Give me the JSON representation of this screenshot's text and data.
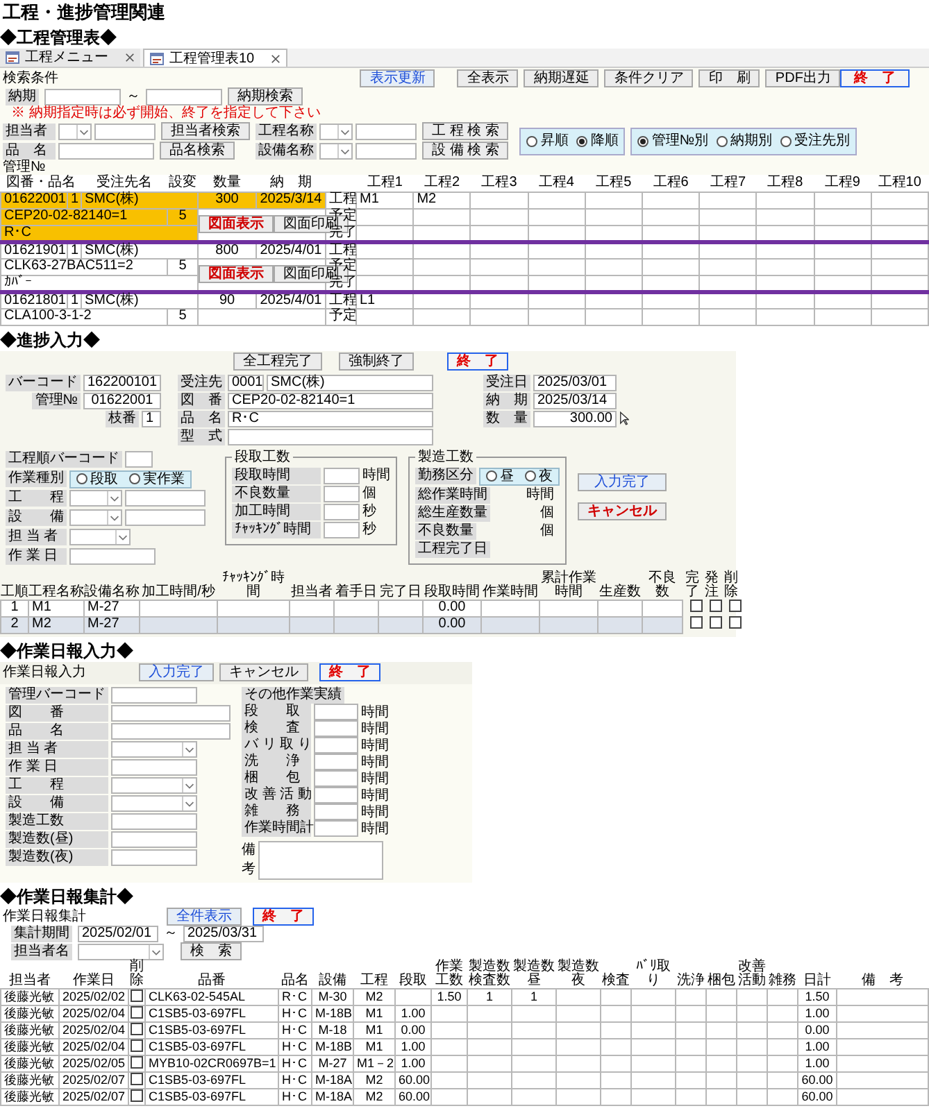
{
  "page_title": "工程・進捗管理関連",
  "schedule": {
    "heading": "◆工程管理表◆",
    "tabs": [
      {
        "label": "工程メニュー",
        "selected": false
      },
      {
        "label": "工程管理表10",
        "selected": true
      }
    ],
    "search_label": "検索条件",
    "top_buttons": [
      {
        "label": "表示更新",
        "kind": "blue"
      },
      {
        "label": "全表示",
        "kind": "plain"
      },
      {
        "label": "納期遅延",
        "kind": "plain"
      },
      {
        "label": "条件クリア",
        "kind": "plain"
      },
      {
        "label": "印　刷",
        "kind": "plain"
      },
      {
        "label": "PDF出力",
        "kind": "plain"
      }
    ],
    "close_button": {
      "label": "終　了",
      "kind": "close"
    },
    "due_label": "納期",
    "due_sep": "～",
    "due_button": {
      "label": "納期検索",
      "kind": "plain"
    },
    "warning": "※ 納期指定時は必ず開始、終了を指定して下さい",
    "filters": [
      {
        "label": "担当者",
        "kind": "combo",
        "button": {
          "label": "担当者検索",
          "kind": "plain"
        }
      },
      {
        "label": "品　名",
        "kind": "text",
        "button": {
          "label": "品名検索",
          "kind": "plain"
        }
      }
    ],
    "filters2": [
      {
        "label": "工程名称",
        "kind": "combo",
        "button": {
          "label": "工 程 検 索",
          "kind": "plain"
        }
      },
      {
        "label": "設備名称",
        "kind": "combo",
        "button": {
          "label": "設 備 検 索",
          "kind": "plain"
        }
      }
    ],
    "sort_order": [
      {
        "label": "昇順",
        "selected": false
      },
      {
        "label": "降順",
        "selected": true
      }
    ],
    "sort_key": [
      {
        "label": "管理№別",
        "selected": true
      },
      {
        "label": "納期別",
        "selected": false
      },
      {
        "label": "受注先別",
        "selected": false
      }
    ],
    "grid_caption": "管理№",
    "columns": [
      "図番・品名",
      "受注先名",
      "設変",
      "数量",
      "納　期",
      "工程1",
      "工程2",
      "工程3",
      "工程4",
      "工程5",
      "工程6",
      "工程7",
      "工程8",
      "工程9",
      "工程10"
    ],
    "records": [
      {
        "selected": true,
        "number": "01622001",
        "branch": "1",
        "customer": "SMC(株)",
        "quantity": "300",
        "due": "2025/3/14",
        "drawing": "CEP20-02-82140=1",
        "change": "5",
        "product": "R･C",
        "buttons": [
          {
            "label": "図面表示",
            "kind": "red"
          },
          {
            "label": "図面印刷",
            "kind": "plain"
          }
        ],
        "row_labels": [
          "工程",
          "予定",
          "完了"
        ],
        "processes": [
          "M1",
          "M2"
        ]
      },
      {
        "selected": false,
        "number": "01621901",
        "branch": "1",
        "customer": "SMC(株)",
        "quantity": "800",
        "due": "2025/4/01",
        "drawing": "CLK63-27BAC511=2",
        "change": "5",
        "product": "ｶﾊﾞｰ",
        "buttons": [
          {
            "label": "図面表示",
            "kind": "red"
          },
          {
            "label": "図面印刷",
            "kind": "plain"
          }
        ],
        "row_labels": [
          "工程",
          "予定",
          "完了"
        ]
      },
      {
        "selected": false,
        "number": "01621801",
        "branch": "1",
        "customer": "SMC(株)",
        "quantity": "90",
        "due": "2025/4/01",
        "drawing": "CLA100-3-1-2",
        "change": "5",
        "row_labels": [
          "工程",
          "予定"
        ],
        "processes": [
          "L1"
        ]
      }
    ]
  },
  "progress": {
    "heading": "◆進捗入力◆",
    "buttons": [
      {
        "label": "全工程完了",
        "kind": "plain"
      },
      {
        "label": "強制終了",
        "kind": "plain"
      },
      {
        "label": "終　了",
        "kind": "close"
      }
    ],
    "info_left": [
      {
        "label": "バーコード",
        "value": "162200101"
      },
      {
        "label": "管理№",
        "value": "01622001"
      },
      {
        "label": "枝番",
        "value": "1"
      }
    ],
    "info_mid": [
      {
        "label": "受注先",
        "values": [
          "0001",
          "SMC(株)"
        ]
      },
      {
        "label": "図　番",
        "values": [
          "CEP20-02-82140=1"
        ]
      },
      {
        "label": "品　名",
        "values": [
          "R･C"
        ]
      },
      {
        "label": "型　式"
      }
    ],
    "info_right": [
      {
        "label": "受注日",
        "value": "2025/03/01"
      },
      {
        "label": "納　期",
        "value": "2025/03/14"
      },
      {
        "label": "数　量",
        "value": "300.00"
      }
    ],
    "entry": [
      {
        "label": "工程順バーコード",
        "kind": "text"
      },
      {
        "label": "作業種別",
        "kind": "radio",
        "options": [
          {
            "label": "段取",
            "selected": false
          },
          {
            "label": "実作業",
            "selected": false
          }
        ]
      },
      {
        "label": "工　　程",
        "kind": "combo_text"
      },
      {
        "label": "設　　備",
        "kind": "combo_text"
      },
      {
        "label": "担 当 者",
        "kind": "combo"
      },
      {
        "label": "作 業 日",
        "kind": "text"
      }
    ],
    "setup": {
      "title": "段取工数",
      "rows": [
        {
          "label": "段取時間",
          "unit": "時間"
        },
        {
          "label": "不良数量",
          "unit": "個"
        },
        {
          "label": "加工時間",
          "unit": "秒"
        },
        {
          "label": "ﾁｬｯｷﾝｸﾞ時間",
          "unit": "秒"
        }
      ]
    },
    "production": {
      "title": "製造工数",
      "shift_label": "勤務区分",
      "shift": [
        {
          "label": "昼",
          "selected": false
        },
        {
          "label": "夜",
          "selected": false
        }
      ],
      "rows": [
        {
          "label": "総作業時間",
          "unit": "時間"
        },
        {
          "label": "総生産数量",
          "unit": "個"
        },
        {
          "label": "不良数量",
          "unit": "個"
        },
        {
          "label": "工程完了日"
        }
      ]
    },
    "side_buttons": [
      {
        "label": "入力完了",
        "kind": "blue"
      },
      {
        "label": "キャンセル",
        "kind": "red"
      }
    ],
    "table": {
      "columns": [
        "工順",
        "工程名称",
        "設備名称",
        "加工時間/秒",
        "ﾁｬｯｷﾝｸﾞ時間",
        "担当者",
        "着手日",
        "完了日",
        "段取時間",
        "作業時間",
        "累計作業時間",
        "生産数",
        "不良数",
        "完了",
        "発注",
        "削除"
      ],
      "rows": [
        {
          "selected": false,
          "cells": [
            "1",
            "M1",
            "M-27",
            "",
            "",
            "",
            "",
            "",
            "0.00",
            "",
            "",
            "",
            "",
            {
              "checked": false
            },
            {
              "checked": false
            },
            {
              "checked": false
            }
          ]
        },
        {
          "selected": true,
          "cells": [
            "2",
            "M2",
            "M-27",
            "",
            "",
            "",
            "",
            "",
            "0.00",
            "",
            "",
            "",
            "",
            {
              "checked": false
            },
            {
              "checked": false
            },
            {
              "checked": false
            }
          ]
        }
      ]
    }
  },
  "daily": {
    "heading": "◆作業日報入力◆",
    "title": "作業日報入力",
    "buttons": [
      {
        "label": "入力完了",
        "kind": "blue"
      },
      {
        "label": "キャンセル",
        "kind": "plain"
      },
      {
        "label": "終　了",
        "kind": "close"
      }
    ],
    "fields": [
      {
        "label": "管理バーコード",
        "kind": "text"
      },
      {
        "label": "図　　番",
        "kind": "wide"
      },
      {
        "label": "品　　名",
        "kind": "wide"
      },
      {
        "label": "担 当 者",
        "kind": "combo"
      },
      {
        "label": "作 業 日",
        "kind": "text"
      },
      {
        "label": "工　　程",
        "kind": "combo"
      },
      {
        "label": "設　　備",
        "kind": "combo"
      },
      {
        "label": "製造工数",
        "kind": "text"
      },
      {
        "label": "製造数(昼)",
        "kind": "text"
      },
      {
        "label": "製造数(夜)",
        "kind": "text"
      }
    ],
    "other_title": "その他作業実績",
    "other_rows": [
      {
        "label": "段　　取",
        "unit": "時間"
      },
      {
        "label": "検　　査",
        "unit": "時間"
      },
      {
        "label": "バ リ 取 り",
        "unit": "時間"
      },
      {
        "label": "洗　　浄",
        "unit": "時間"
      },
      {
        "label": "梱　　包",
        "unit": "時間"
      },
      {
        "label": "改 善 活 動",
        "unit": "時間"
      },
      {
        "label": "雑　　務",
        "unit": "時間"
      },
      {
        "label": "作業時間計",
        "unit": "時間"
      }
    ],
    "remarks_label": "備考"
  },
  "summary": {
    "heading": "◆作業日報集計◆",
    "title": "作業日報集計",
    "buttons": [
      {
        "label": "全件表示",
        "kind": "blue"
      },
      {
        "label": "終　了",
        "kind": "close"
      }
    ],
    "period_label": "集計期間",
    "period_from": "2025/02/01",
    "period_sep": "～",
    "period_to": "2025/03/31",
    "person_label": "担当者名",
    "search_button": {
      "label": "検　索",
      "kind": "plain"
    },
    "columns": [
      "担当者",
      "作業日",
      "削除",
      "品番",
      "品名",
      "設備",
      "工程",
      "段取",
      "作業工数",
      "製造数検査数",
      "製造数昼",
      "製造数夜",
      "検査",
      "ﾊﾞﾘ取り",
      "洗浄",
      "梱包",
      "改善活動",
      "雑務",
      "日計",
      "備　考"
    ],
    "rows": [
      {
        "cells": [
          "後藤光敏",
          "2025/02/02",
          {
            "checked": false
          },
          "CLK63-02-545AL",
          "R･C",
          "M-30",
          "M2",
          "",
          "1.50",
          "1",
          "1",
          "",
          "",
          "",
          "",
          "",
          "",
          "",
          "1.50",
          ""
        ]
      },
      {
        "cells": [
          "後藤光敏",
          "2025/02/04",
          {
            "checked": false
          },
          "C1SB5-03-697FL",
          "H･C",
          "M-18B",
          "M1",
          "1.00",
          "",
          "",
          "",
          "",
          "",
          "",
          "",
          "",
          "",
          "",
          "1.00",
          ""
        ]
      },
      {
        "cells": [
          "後藤光敏",
          "2025/02/04",
          {
            "checked": false
          },
          "C1SB5-03-697FL",
          "H･C",
          "M-18",
          "M1",
          "0.00",
          "",
          "",
          "",
          "",
          "",
          "",
          "",
          "",
          "",
          "",
          "0.00",
          ""
        ]
      },
      {
        "cells": [
          "後藤光敏",
          "2025/02/04",
          {
            "checked": false
          },
          "C1SB5-03-697FL",
          "H･C",
          "M-18B",
          "M1",
          "1.00",
          "",
          "",
          "",
          "",
          "",
          "",
          "",
          "",
          "",
          "",
          "1.00",
          ""
        ]
      },
      {
        "cells": [
          "後藤光敏",
          "2025/02/05",
          {
            "checked": false
          },
          "MYB10-02CR0697B=1",
          "H･C",
          "M-27",
          "M1－2",
          "1.00",
          "",
          "",
          "",
          "",
          "",
          "",
          "",
          "",
          "",
          "",
          "1.00",
          ""
        ]
      },
      {
        "cells": [
          "後藤光敏",
          "2025/02/07",
          {
            "checked": false
          },
          "C1SB5-03-697FL",
          "H･C",
          "M-18A",
          "M2",
          "60.00",
          "",
          "",
          "",
          "",
          "",
          "",
          "",
          "",
          "",
          "",
          "60.00",
          ""
        ]
      },
      {
        "cells": [
          "後藤光敏",
          "2025/02/07",
          {
            "checked": false
          },
          "C1SB5-03-697FL",
          "H･C",
          "M-18A",
          "M2",
          "60.00",
          "",
          "",
          "",
          "",
          "",
          "",
          "",
          "",
          "",
          "",
          "60.00",
          ""
        ]
      }
    ]
  }
}
